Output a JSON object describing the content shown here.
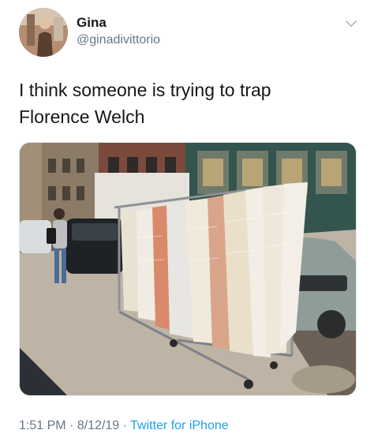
{
  "author": {
    "name": "Gina",
    "handle": "@ginadivittorio"
  },
  "tweet": {
    "text_lines": [
      "I think someone is trying to trap",
      "Florence Welch"
    ]
  },
  "media": {
    "subject": "clothing-rack-with-vintage-dresses-on-street"
  },
  "meta": {
    "time": "1:51 PM",
    "sep1": " · ",
    "date": "8/12/19",
    "sep2": " · ",
    "source": "Twitter for iPhone"
  },
  "icons": {
    "more": "chevron-down-icon"
  },
  "colors": {
    "text": "#14171a",
    "secondary": "#657786",
    "link": "#1da1f2"
  }
}
